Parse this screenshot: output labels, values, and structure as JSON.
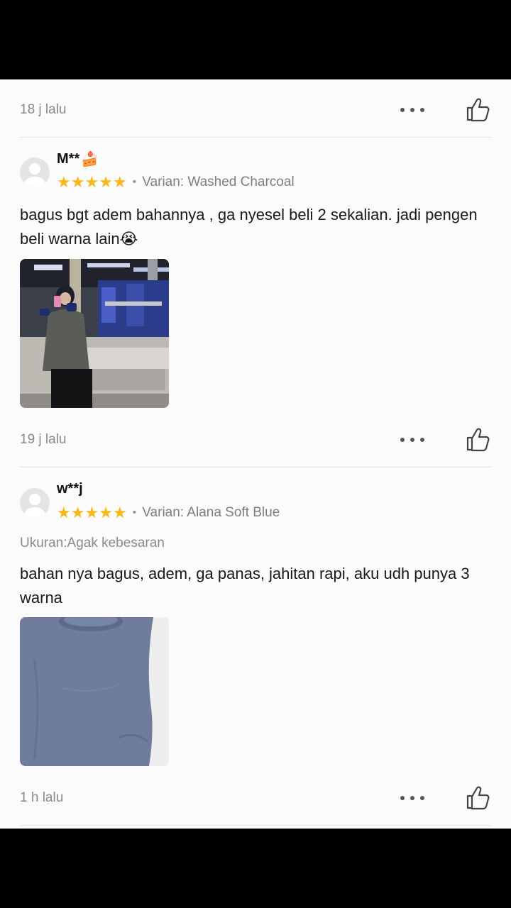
{
  "review_top": {
    "time": "18 j lalu"
  },
  "reviews": [
    {
      "username": "M**",
      "user_emoji": "🍰",
      "rating": 5,
      "variant": "Varian: Washed Charcoal",
      "size_note": "",
      "text": "bagus bgt adem bahannya , ga nyesel beli 2 sekalian. jadi pengen beli warna lain😭",
      "photo_icon": "photo-gym-mirror-selfie",
      "time": "19 j lalu"
    },
    {
      "username": "w**j",
      "user_emoji": "",
      "rating": 5,
      "variant": "Varian: Alana Soft Blue",
      "size_note": "Ukuran:Agak kebesaran",
      "text": "bahan nya bagus, adem, ga panas, jahitan rapi, aku udh punya 3 warna",
      "photo_icon": "photo-blue-shirt",
      "time": "1 h lalu"
    }
  ],
  "colors": {
    "star": "#f7b81a",
    "background": "#fbfbfb",
    "muted_text": "#8a8a8a"
  },
  "icons": {
    "more": "more-dots-icon",
    "like": "thumbs-up-icon",
    "star": "star-icon",
    "avatar": "default-avatar-icon"
  }
}
